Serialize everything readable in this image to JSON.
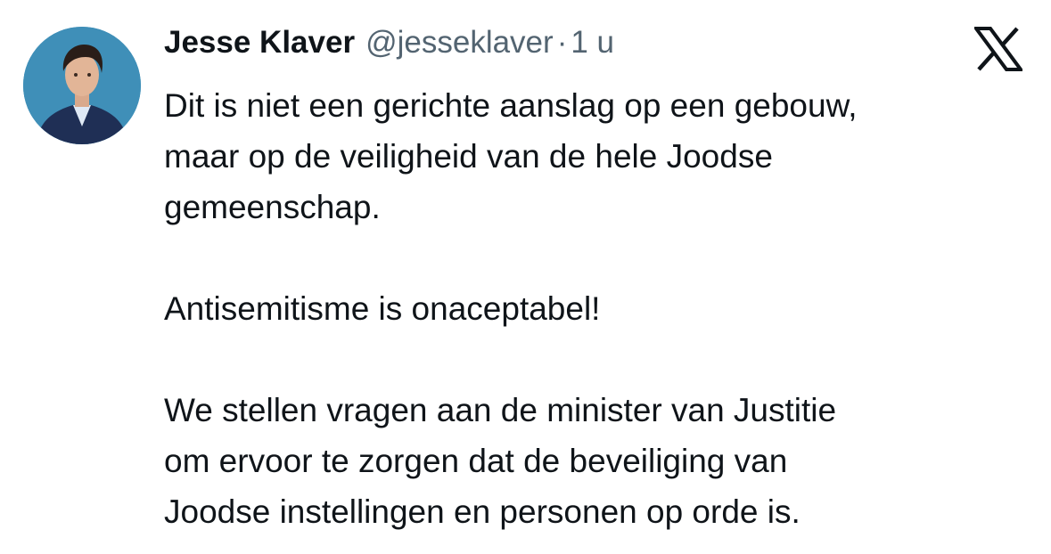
{
  "author": {
    "display_name": "Jesse Klaver",
    "handle": "@jesseklaver",
    "separator": "·",
    "timestamp": "1 u",
    "avatar_icon": "profile-photo"
  },
  "platform": {
    "logo_icon": "x-logo"
  },
  "tweet": {
    "paragraph1_lines": [
      "Dit is niet een gerichte aanslag op een gebouw,",
      "maar op de veiligheid van de hele Joodse",
      "gemeenschap."
    ],
    "paragraph2_lines": [
      "Antisemitisme is onaceptabel!"
    ],
    "paragraph3_lines": [
      "We stellen vragen aan de minister van Justitie",
      "om ervoor te zorgen dat de beveiliging van",
      "Joodse instellingen en personen op orde is."
    ]
  },
  "colors": {
    "text_primary": "#0f1419",
    "text_secondary": "#536471",
    "background": "#ffffff",
    "avatar_background": "#3f8fb8"
  }
}
